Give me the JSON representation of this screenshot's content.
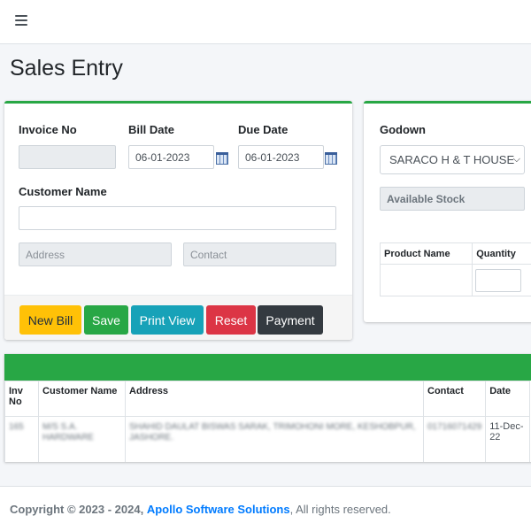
{
  "page": {
    "title": "Sales Entry"
  },
  "form": {
    "invoice_no_label": "Invoice No",
    "invoice_no_value": "",
    "bill_date_label": "Bill Date",
    "bill_date_value": "06-01-2023",
    "due_date_label": "Due Date",
    "due_date_value": "06-01-2023",
    "customer_name_label": "Customer Name",
    "customer_name_value": "",
    "address_placeholder": "Address",
    "contact_placeholder": "Contact"
  },
  "buttons": {
    "new_bill": "New Bill",
    "save": "Save",
    "print_view": "Print View",
    "reset": "Reset",
    "payment": "Payment"
  },
  "colors": {
    "accent": "#28a745",
    "new_bill": "#ffc107",
    "save": "#28a745",
    "print_view": "#17a2b8",
    "reset": "#dc3545",
    "payment": "#343a40",
    "link": "#007bff"
  },
  "godown": {
    "label": "Godown",
    "selected": "SARACO H & T HOUSE",
    "available_stock_placeholder": "Available Stock",
    "table_headers": {
      "product_name": "Product Name",
      "quantity": "Quantity"
    }
  },
  "sales_list": {
    "headers": {
      "inv_no": "Inv No",
      "customer_name": "Customer Name",
      "address": "Address",
      "contact": "Contact",
      "date": "Date"
    },
    "rows": [
      {
        "inv_no": "165",
        "customer_name": "M/S S.A. HARDWARE",
        "address": "SHAHID DAULAT BISWAS SARAK, TRIMOHONI MORE, KESHOBPUR, JASHORE.",
        "contact": "01716071429",
        "date": "11-Dec-22"
      }
    ]
  },
  "footer": {
    "copyright": "Copyright © 2023 - 2024,",
    "company": "Apollo Software Solutions",
    "rights": ", All rights reserved."
  }
}
